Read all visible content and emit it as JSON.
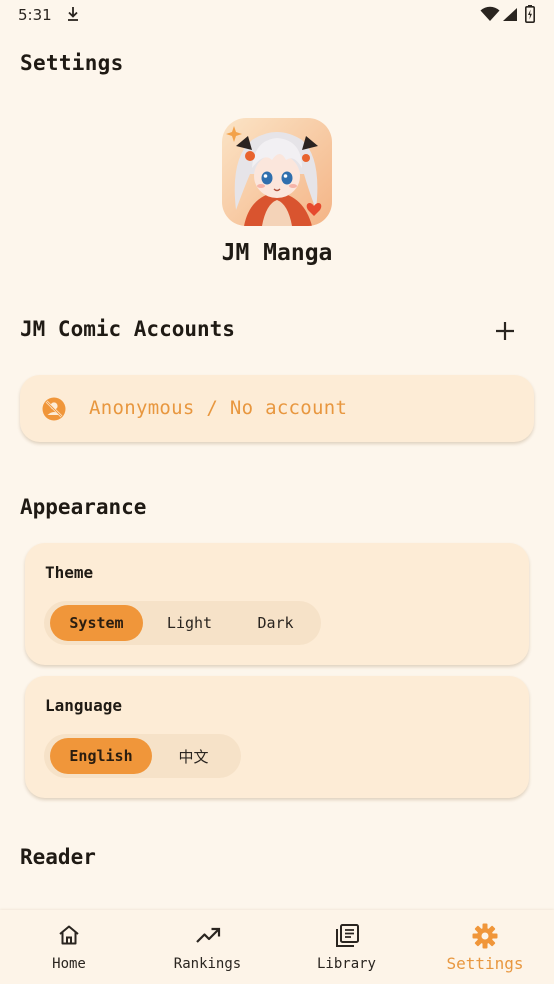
{
  "status_bar": {
    "time": "5:31"
  },
  "header": {
    "title": "Settings"
  },
  "app": {
    "name": "JM Manga"
  },
  "accounts": {
    "title": "JM Comic Accounts",
    "current": "Anonymous / No account"
  },
  "appearance": {
    "title": "Appearance",
    "theme": {
      "label": "Theme",
      "options": [
        "System",
        "Light",
        "Dark"
      ],
      "selected": "System"
    },
    "language": {
      "label": "Language",
      "options": [
        "English",
        "中文"
      ],
      "selected": "English"
    }
  },
  "reader": {
    "title": "Reader"
  },
  "nav": {
    "items": [
      {
        "label": "Home",
        "icon": "home-icon"
      },
      {
        "label": "Rankings",
        "icon": "trending-icon"
      },
      {
        "label": "Library",
        "icon": "library-icon"
      },
      {
        "label": "Settings",
        "icon": "gear-icon"
      }
    ],
    "active": "Settings"
  },
  "colors": {
    "accent": "#f0963a",
    "background": "#fdf6ec",
    "card": "#fdecd6"
  }
}
